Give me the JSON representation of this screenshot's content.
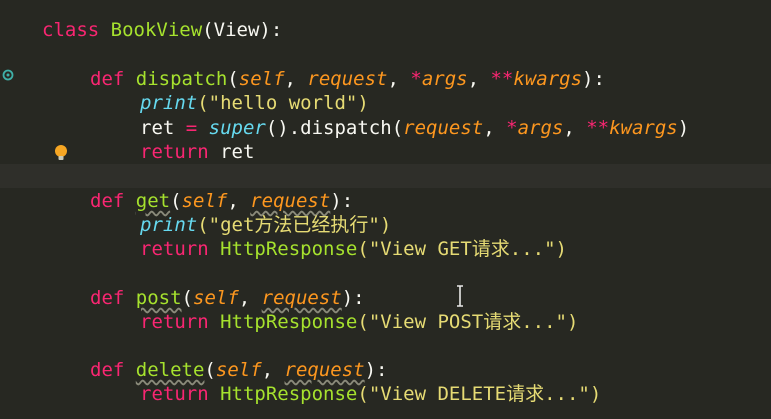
{
  "editor": {
    "lines": [
      {
        "tokens": [
          "class",
          "BookView",
          "(",
          "View",
          "):"
        ]
      },
      {
        "tokens": [
          "def",
          "dispatch",
          "(",
          "self",
          ", ",
          "request",
          ", ",
          "*",
          "args",
          ", ",
          "**",
          "kwargs",
          "):"
        ]
      },
      {
        "tokens": [
          "print",
          "(\"hello world\")"
        ]
      },
      {
        "tokens": [
          "ret",
          " = ",
          "super",
          "().dispatch(",
          "request",
          ", ",
          "*",
          "args",
          ", ",
          "**",
          "kwargs",
          ")"
        ]
      },
      {
        "tokens": [
          "return",
          " ret"
        ]
      },
      {
        "tokens": [
          "def",
          "get",
          "(",
          "self",
          ", ",
          "request",
          "):"
        ]
      },
      {
        "tokens": [
          "print",
          "(\"get方法已经执行\")"
        ]
      },
      {
        "tokens": [
          "return",
          "HttpResponse",
          "(\"View GET请求...\")"
        ]
      },
      {
        "tokens": [
          "def",
          "post",
          "(",
          "self",
          ", ",
          "request",
          "):"
        ]
      },
      {
        "tokens": [
          "return",
          "HttpResponse",
          "(\"View POST请求...\")"
        ]
      },
      {
        "tokens": [
          "def",
          "delete",
          "(",
          "self",
          ", ",
          "request",
          "):"
        ]
      },
      {
        "tokens": [
          "return",
          "HttpResponse",
          "(\"View DELETE请求...\")"
        ]
      }
    ]
  },
  "colors": {
    "background": "#272822",
    "keyword": "#f92672",
    "function": "#a6e22e",
    "parameter": "#fd971f",
    "string": "#e6db74",
    "builtin": "#66d9ef",
    "text": "#f8f8f2"
  },
  "icons": {
    "override": "override-marker-icon",
    "intention": "lightbulb-icon",
    "cursor": "text-cursor-icon"
  }
}
